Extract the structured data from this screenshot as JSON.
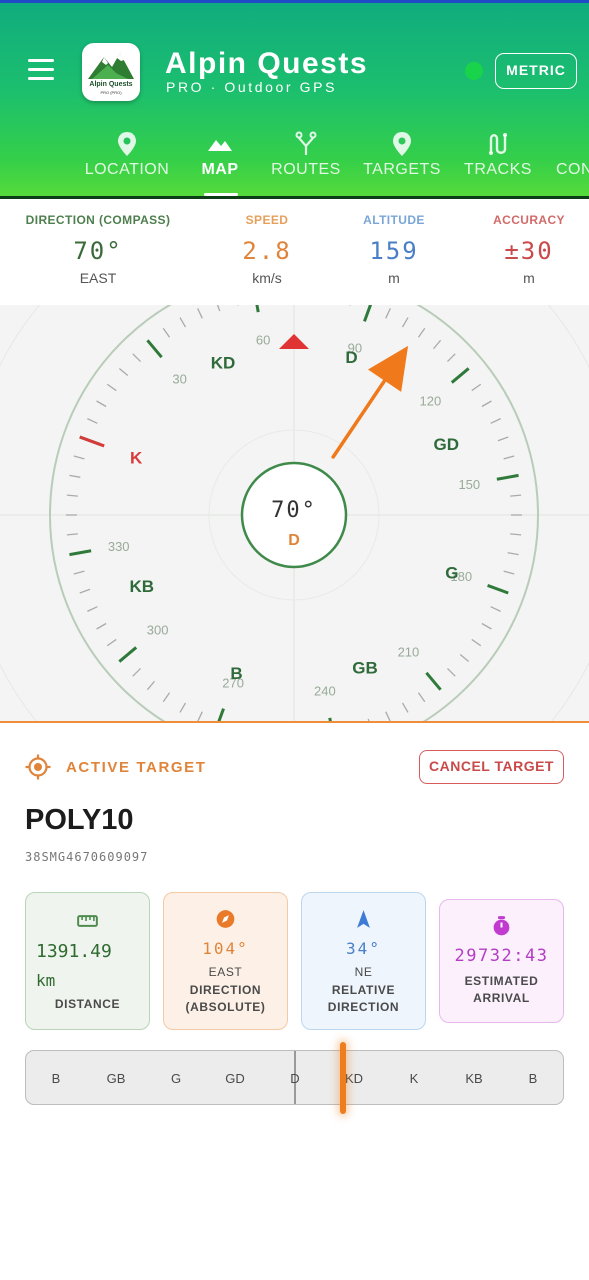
{
  "header": {
    "title": "Alpin Quests",
    "subtitle": "PRO · Outdoor GPS",
    "logo_text": "Alpin Quests",
    "logo_subtext": "PRO (PRO)",
    "unit_button": "METRIC",
    "status_color": "#19d34a"
  },
  "tabs": [
    {
      "label": "LOCATION",
      "icon": "map-pin-icon"
    },
    {
      "label": "MAP",
      "icon": "mountain-icon",
      "active": true
    },
    {
      "label": "ROUTES",
      "icon": "route-fork-icon"
    },
    {
      "label": "TARGETS",
      "icon": "map-pin-icon"
    },
    {
      "label": "TRACKS",
      "icon": "track-path-icon"
    },
    {
      "label": "CON",
      "icon": "settings-icon"
    }
  ],
  "stats": {
    "direction": {
      "label": "DIRECTION (COMPASS)",
      "value": "70°",
      "unit": "EAST",
      "color": "#3a7d3a"
    },
    "speed": {
      "label": "SPEED",
      "value": "2.8",
      "unit": "km/s",
      "color": "#e0843a"
    },
    "altitude": {
      "label": "ALTITUDE",
      "value": "159",
      "unit": "m",
      "color": "#4a7fc8"
    },
    "accuracy": {
      "label": "ACCURACY",
      "value": "±30",
      "unit": "m",
      "color": "#c94a4a"
    }
  },
  "compass": {
    "heading": "70°",
    "heading_letter": "D",
    "cardinal_labels": [
      "KD",
      "D",
      "GD",
      "G",
      "GB",
      "B",
      "KB",
      "K"
    ],
    "degree_labels": [
      "60",
      "90",
      "120",
      "150",
      "180",
      "210",
      "240",
      "270",
      "300",
      "330",
      "30"
    ],
    "target_arrow_color": "#f0791c",
    "north_marker_color": "#e03434"
  },
  "target": {
    "section_label": "ACTIVE TARGET",
    "cancel_label": "CANCEL TARGET",
    "name": "POLY10",
    "coordinate": "38SMG4670609097",
    "distance": {
      "value": "1391.49",
      "unit": "km",
      "label": "DISTANCE",
      "icon": "ruler-icon"
    },
    "direction": {
      "value": "104°",
      "sub": "EAST",
      "label1": "DIRECTION",
      "label2": "(ABSOLUTE)",
      "icon": "compass-icon"
    },
    "relative": {
      "value": "34°",
      "sub": "NE",
      "label1": "RELATIVE",
      "label2": "DIRECTION",
      "icon": "navigation-arrow-icon"
    },
    "arrival": {
      "value": "29732:43",
      "label1": "ESTIMATED",
      "label2": "ARRIVAL",
      "icon": "stopwatch-icon"
    }
  },
  "heading_strip": {
    "labels": [
      "B",
      "GB",
      "G",
      "GD",
      "D",
      "KD",
      "K",
      "KB",
      "B"
    ],
    "marker_color": "#ef7d1e"
  }
}
